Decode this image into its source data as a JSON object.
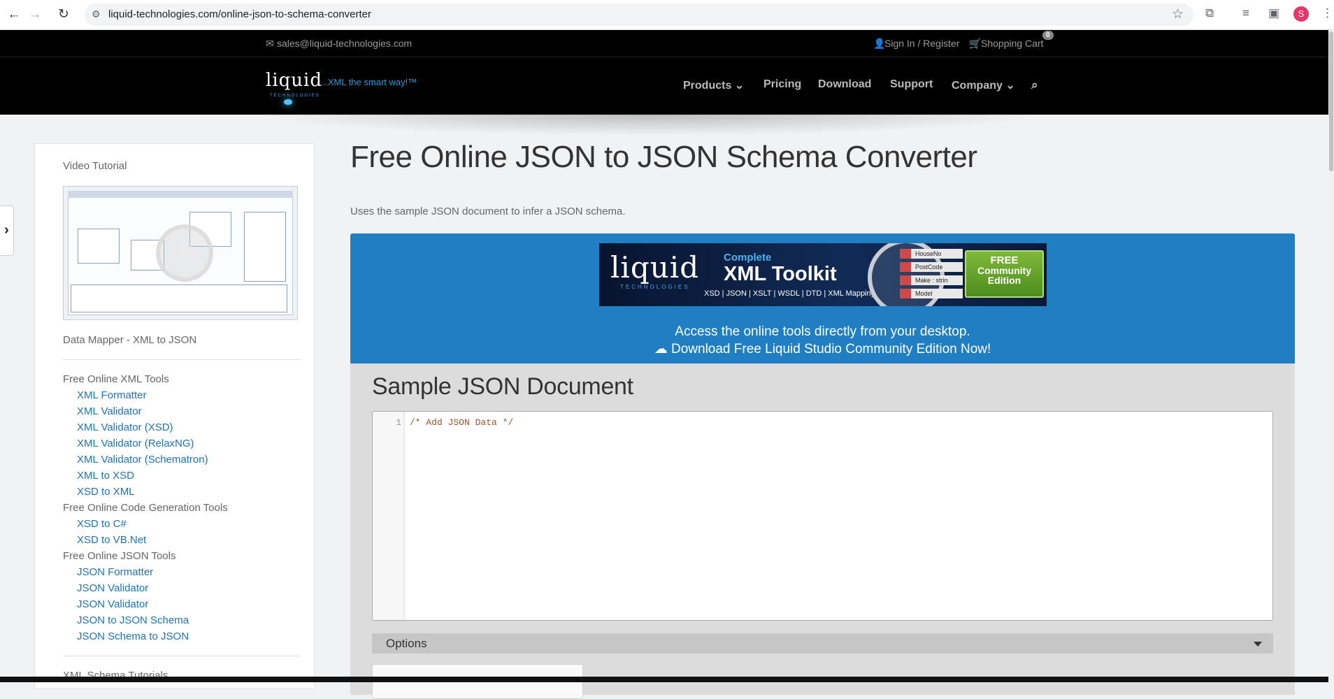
{
  "browser": {
    "url": "liquid-technologies.com/online-json-to-schema-converter",
    "avatar_letter": "S",
    "icons": [
      "back-icon",
      "forward-icon",
      "reload-icon",
      "site-info-icon",
      "star-icon",
      "extensions-icon",
      "media-icon",
      "sidepanel-icon",
      "menu-icon"
    ]
  },
  "topbar": {
    "email": "sales@liquid-technologies.com",
    "signin": "Sign In / Register",
    "cart": "Shopping Cart",
    "cart_count": "0"
  },
  "header": {
    "logo_word": "liquid",
    "logo_sub": "TECHNOLOGIES",
    "logo_tagline": "...XML the smart way!™",
    "nav": [
      "Products",
      "Pricing",
      "Download",
      "Support",
      "Company"
    ]
  },
  "sidebar": {
    "video_heading": "Video Tutorial",
    "video_caption": "Data Mapper - XML to JSON",
    "groups": [
      {
        "heading": "Free Online XML Tools",
        "items": [
          "XML Formatter",
          "XML Validator",
          "XML Validator (XSD)",
          "XML Validator (RelaxNG)",
          "XML Validator (Schematron)",
          "XML to XSD",
          "XSD to XML"
        ]
      },
      {
        "heading": "Free Online Code Generation Tools",
        "items": [
          "XSD to C#",
          "XSD to VB.Net"
        ]
      },
      {
        "heading": "Free Online JSON Tools",
        "items": [
          "JSON Formatter",
          "JSON Validator",
          "JSON Validator",
          "JSON to JSON Schema",
          "JSON Schema to JSON"
        ]
      }
    ],
    "partial_heading": "XML Schema Tutorials"
  },
  "main": {
    "title": "Free Online JSON to JSON Schema Converter",
    "subtitle": "Uses the sample JSON document to infer a JSON schema.",
    "banner": {
      "word": "liquid",
      "tech": "TECHNOLOGIES",
      "complete": "Complete",
      "product": "XML Toolkit",
      "formats": "XSD | JSON | XSLT | WSDL | DTD | XML Mapping",
      "tags": [
        "HouseNo",
        "PostCode",
        "Make : strin",
        "Model"
      ],
      "free": [
        "FREE",
        "Community",
        "Edition"
      ]
    },
    "access_line": "Access the online tools directly from your desktop.",
    "download_line": "Download Free Liquid Studio Community Edition Now!",
    "panel_title": "Sample JSON Document",
    "editor": {
      "line_number": "1",
      "code": "/* Add JSON Data */"
    },
    "options_label": "Options"
  },
  "colors": {
    "accent_blue": "#1f7fc2",
    "link": "#1d73b8",
    "header_bg": "#000000"
  }
}
